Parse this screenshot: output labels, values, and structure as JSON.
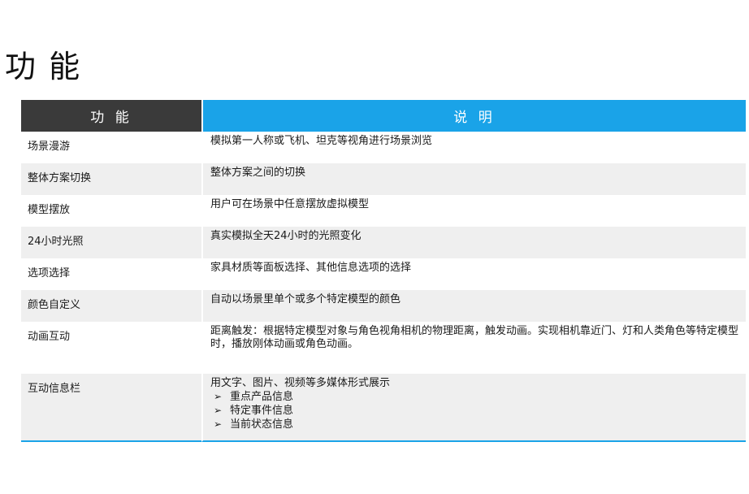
{
  "page": {
    "title": "功 能"
  },
  "table": {
    "headers": [
      "功 能",
      "说 明"
    ],
    "rows": [
      {
        "name": "场景漫游",
        "desc": "模拟第一人称或飞机、坦克等视角进行场景浏览"
      },
      {
        "name": "整体方案切换",
        "desc": "整体方案之间的切换"
      },
      {
        "name": "模型摆放",
        "desc": "用户可在场景中任意摆放虚拟模型"
      },
      {
        "name": "24小时光照",
        "desc": "真实模拟全天24小时的光照变化"
      },
      {
        "name": "选项选择",
        "desc": "家具材质等面板选择、其他信息选项的选择"
      },
      {
        "name": "颜色自定义",
        "desc": "自动以场景里单个或多个特定模型的颜色"
      },
      {
        "name": "动画互动",
        "desc": "距离触发：根据特定模型对象与角色视角相机的物理距离，触发动画。实现相机靠近门、灯和人类角色等特定模型时，播放刚体动画或角色动画。"
      },
      {
        "name": "互动信息栏",
        "desc": "用文字、图片、视频等多媒体形式展示",
        "bullet_mark": "➢",
        "bullets": [
          "重点产品信息",
          "特定事件信息",
          "当前状态信息"
        ]
      }
    ]
  },
  "colors": {
    "header_left": "#3a3a3a",
    "header_right": "#1aa3e8",
    "row_alt": "#efefef",
    "bottom_rule": "#1aa3e8"
  }
}
